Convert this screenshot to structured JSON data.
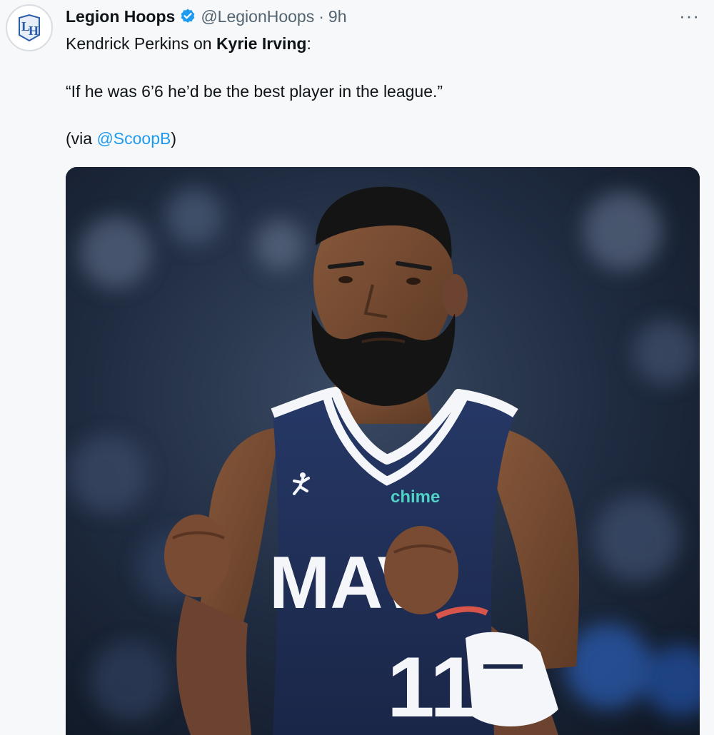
{
  "tweet": {
    "author": {
      "name": "Legion Hoops",
      "handle": "@LegionHoops",
      "time": "9h",
      "separator": "·",
      "avatar_icon": "legion-hoops-logo-icon",
      "verified_icon": "verified-badge-icon"
    },
    "more_label": "···",
    "text": {
      "line1_prefix": "Kendrick Perkins on ",
      "line1_bold": "Kyrie Irving",
      "line1_suffix": ":",
      "quote": "“If he was 6’6 he’d be the best player in the league.”",
      "via_prefix": "(via ",
      "via_mention": "@ScoopB",
      "via_suffix": ")"
    },
    "media": {
      "jersey_sponsor": "chime",
      "jersey_wordmark": "MAV",
      "jersey_number": "11"
    }
  },
  "colors": {
    "background": "#f7f8f9",
    "text": "#0f1419",
    "secondary_text": "#536471",
    "link": "#1d9bf0",
    "verified": "#1d9bf0",
    "jersey": "#1f2d55",
    "sponsor": "#4fd1c5"
  }
}
